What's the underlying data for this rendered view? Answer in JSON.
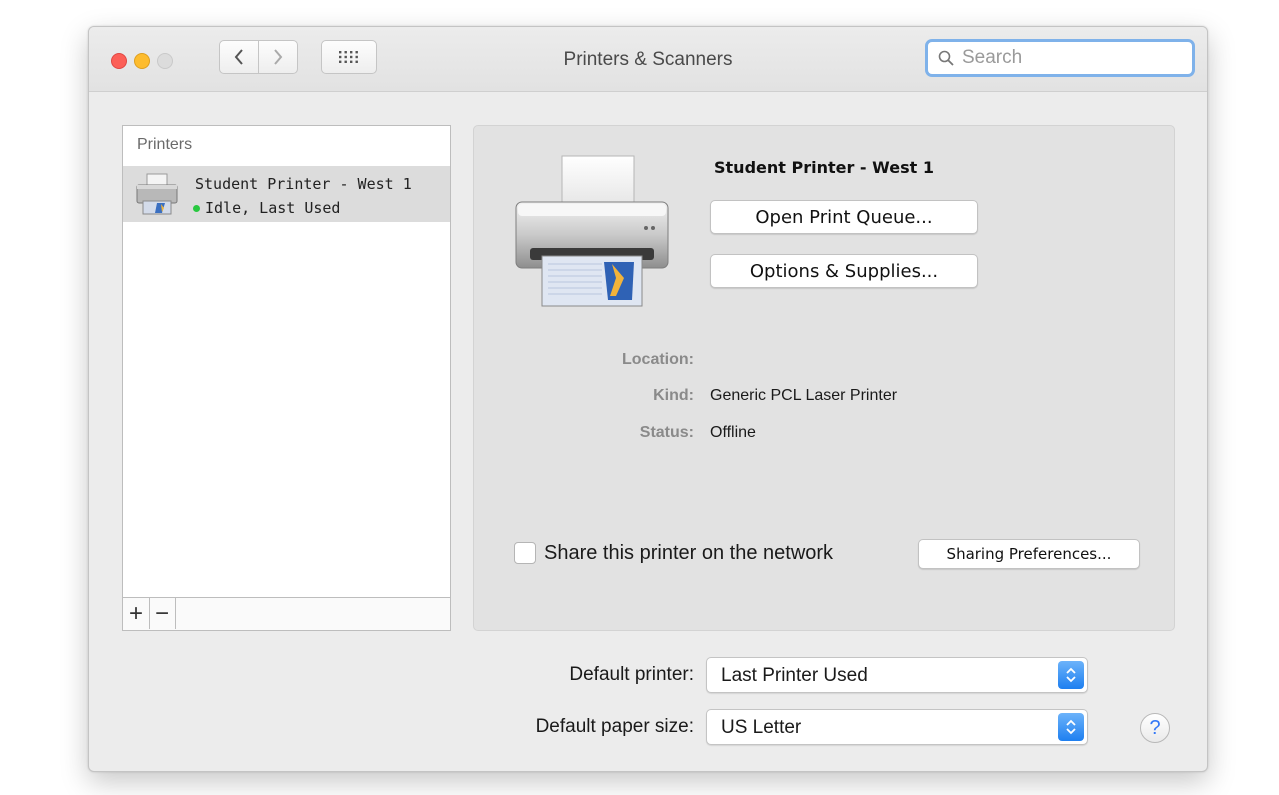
{
  "window": {
    "title": "Printers & Scanners"
  },
  "toolbar": {
    "back_icon": "chevron-left-icon",
    "forward_icon": "chevron-right-icon",
    "show_all_icon": "grid-icon",
    "search_placeholder": "Search"
  },
  "printers": {
    "header": "Printers",
    "items": [
      {
        "name": "Student Printer - West 1",
        "status": "Idle, Last Used",
        "status_color": "#28c840"
      }
    ],
    "add_label": "+",
    "remove_label": "−"
  },
  "detail": {
    "name": "Student Printer - West 1",
    "open_queue_label": "Open Print Queue...",
    "options_label": "Options & Supplies...",
    "location_label": "Location:",
    "location_value": "",
    "kind_label": "Kind:",
    "kind_value": "Generic PCL Laser Printer",
    "status_label": "Status:",
    "status_value": "Offline",
    "share_label": "Share this printer on the network",
    "share_checked": false,
    "sharing_prefs_label": "Sharing Preferences..."
  },
  "defaults": {
    "printer_label": "Default printer:",
    "printer_value": "Last Printer Used",
    "paper_label": "Default paper size:",
    "paper_value": "US Letter"
  },
  "help_label": "?",
  "colors": {
    "accent": "#3478f6",
    "search_focus": "#7fb2ea",
    "selection": "#dcdcdc"
  }
}
